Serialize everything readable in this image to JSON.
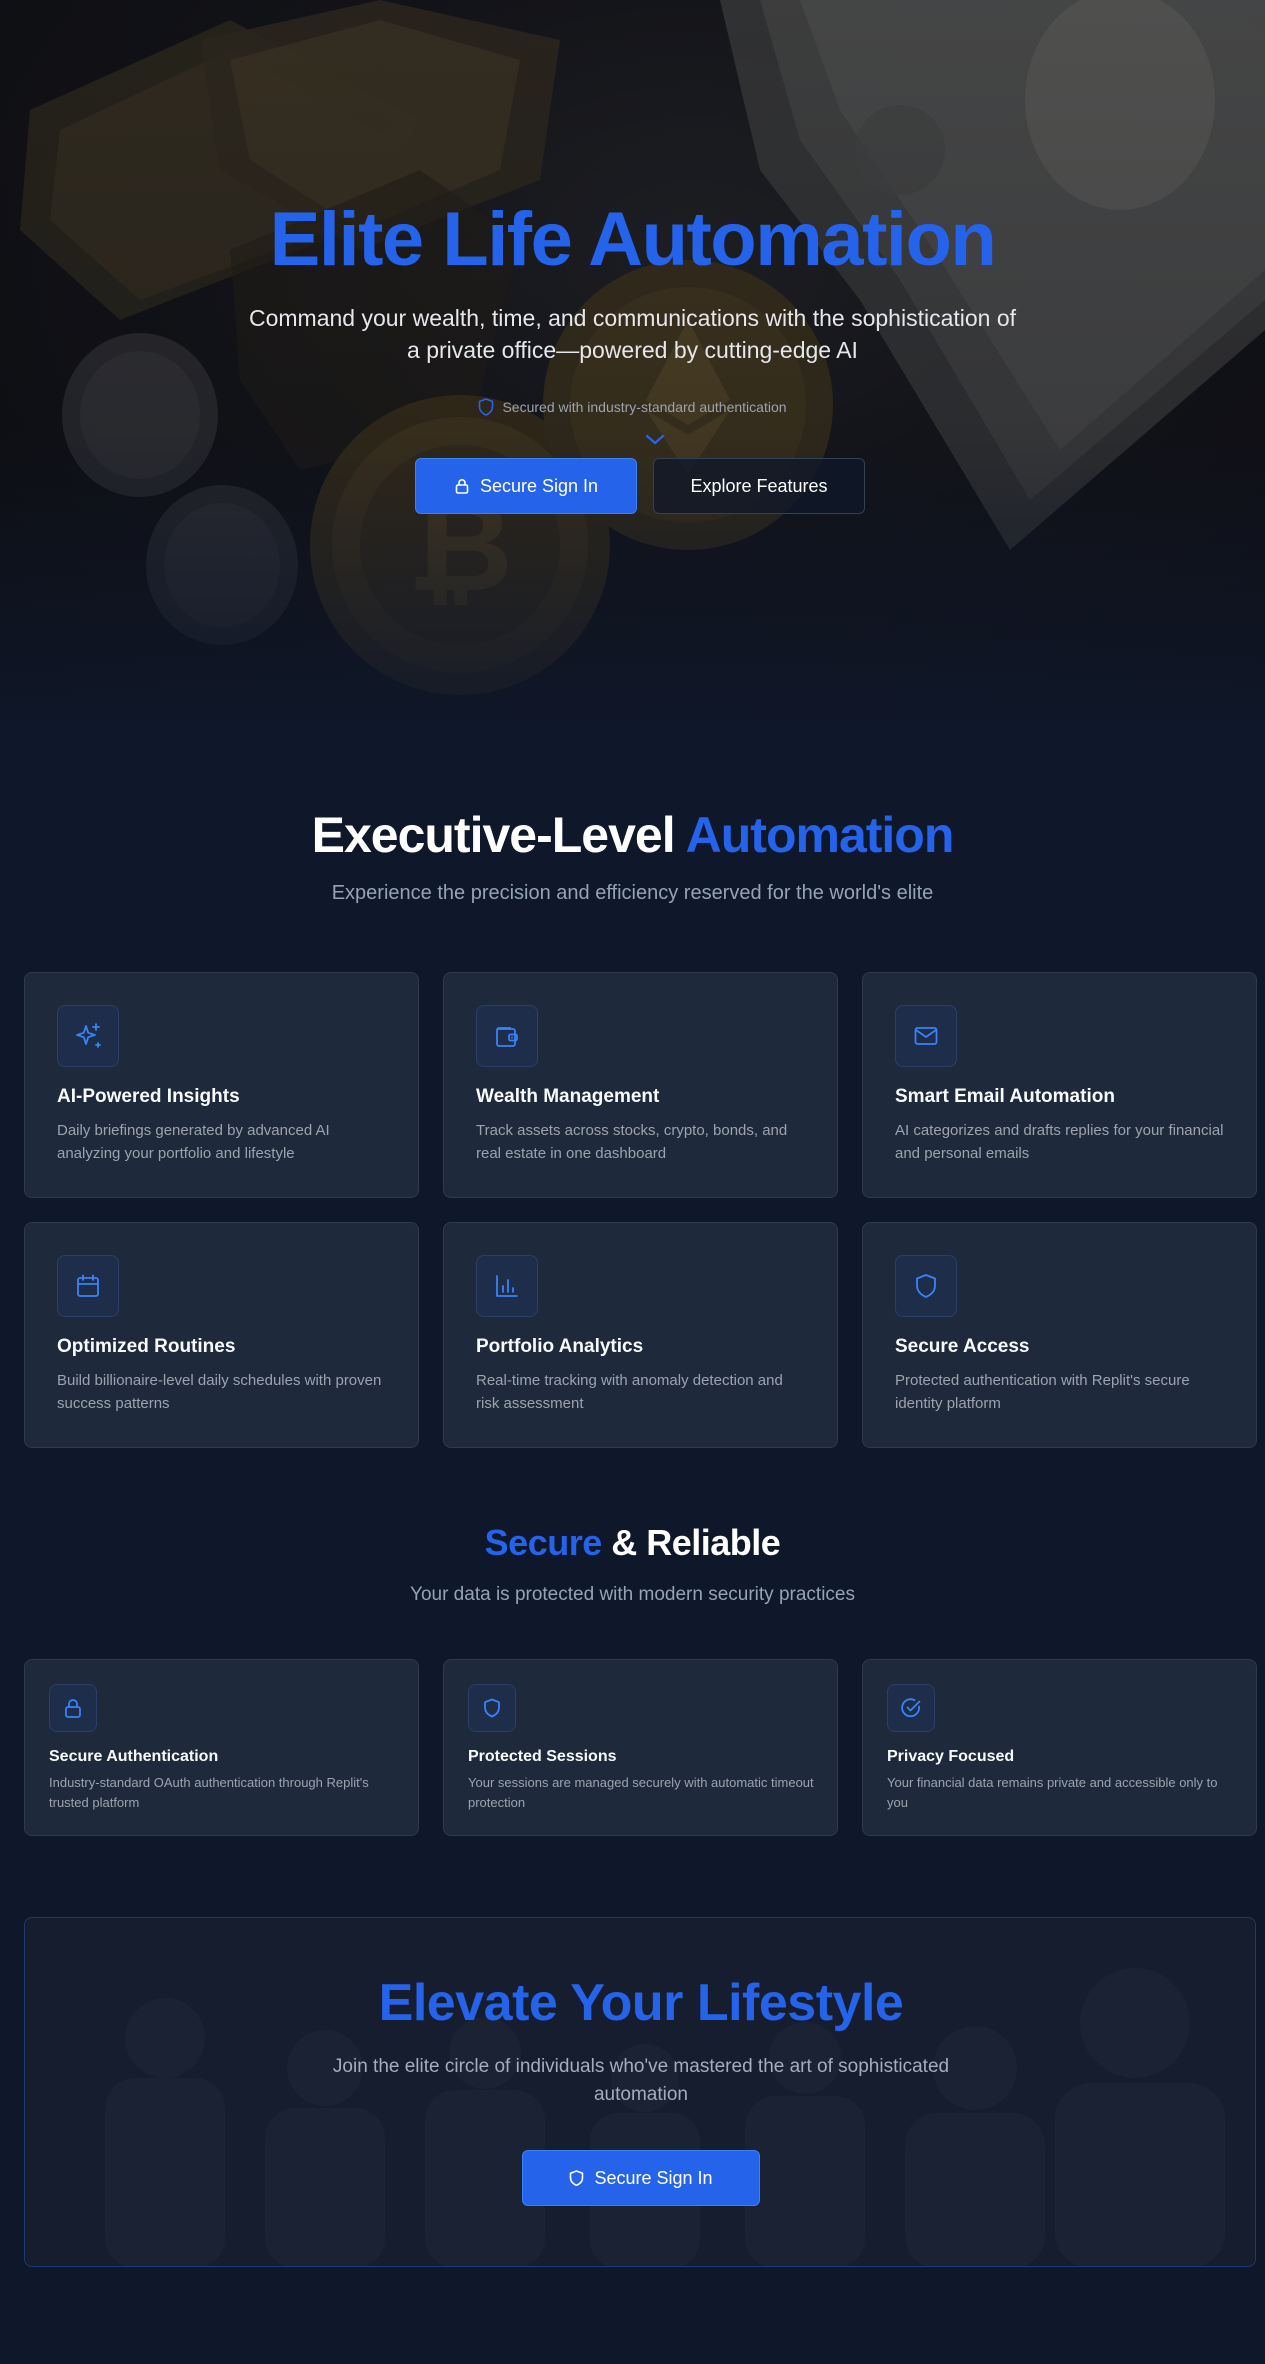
{
  "hero": {
    "title": "Elite Life Automation",
    "subtitle": "Command your wealth, time, and communications with the sophistication of a private office—powered by cutting-edge AI",
    "secure_note": "Secured with industry-standard authentication",
    "primary_button": "Secure Sign In",
    "secondary_button": "Explore Features"
  },
  "features": {
    "title_plain": "Executive-Level",
    "title_accent": "Automation",
    "subtitle": "Experience the precision and efficiency reserved for the world's elite",
    "items": [
      {
        "icon": "sparkles-icon",
        "title": "AI-Powered Insights",
        "desc": "Daily briefings generated by advanced AI analyzing your portfolio and lifestyle"
      },
      {
        "icon": "wallet-icon",
        "title": "Wealth Management",
        "desc": "Track assets across stocks, crypto, bonds, and real estate in one dashboard"
      },
      {
        "icon": "mail-icon",
        "title": "Smart Email Automation",
        "desc": "AI categorizes and drafts replies for your financial and personal emails"
      },
      {
        "icon": "calendar-icon",
        "title": "Optimized Routines",
        "desc": "Build billionaire-level daily schedules with proven success patterns"
      },
      {
        "icon": "bar-chart-icon",
        "title": "Portfolio Analytics",
        "desc": "Real-time tracking with anomaly detection and risk assessment"
      },
      {
        "icon": "shield-icon",
        "title": "Secure Access",
        "desc": "Protected authentication with Replit's secure identity platform"
      }
    ]
  },
  "security": {
    "title_accent": "Secure",
    "title_plain": "& Reliable",
    "subtitle": "Your data is protected with modern security practices",
    "items": [
      {
        "icon": "lock-icon",
        "title": "Secure Authentication",
        "desc": "Industry-standard OAuth authentication through Replit's trusted platform"
      },
      {
        "icon": "shield-icon",
        "title": "Protected Sessions",
        "desc": "Your sessions are managed securely with automatic timeout protection"
      },
      {
        "icon": "check-circle-icon",
        "title": "Privacy Focused",
        "desc": "Your financial data remains private and accessible only to you"
      }
    ]
  },
  "cta": {
    "title": "Elevate Your Lifestyle",
    "subtitle": "Join the elite circle of individuals who've mastered the art of sophisticated automation",
    "button": "Secure Sign In"
  },
  "colors": {
    "accent": "#2563eb",
    "background": "#0f172a",
    "card": "#1e293b",
    "muted_text": "#9ca3af"
  }
}
